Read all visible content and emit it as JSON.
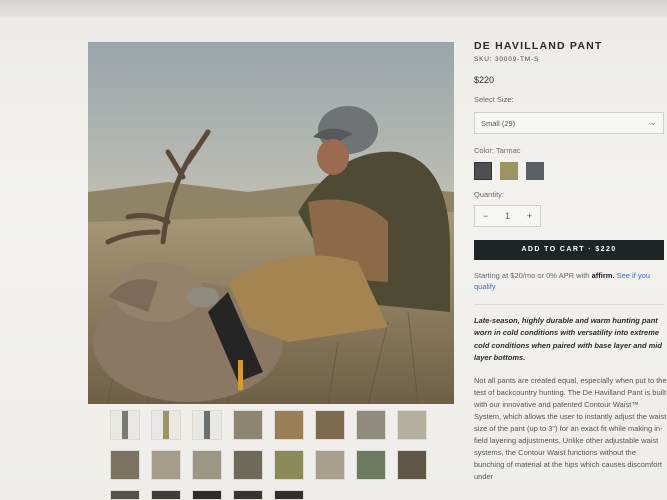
{
  "product": {
    "title": "DE HAVILLAND PANT",
    "sku": "SKU: 30009-TM-S",
    "price": "$220"
  },
  "size": {
    "label": "Select Size:",
    "selected": "Small (29)"
  },
  "color": {
    "label": "Color: Tarmac",
    "swatches": [
      "#4e4f50",
      "#9d9561",
      "#5b6064"
    ]
  },
  "quantity": {
    "label": "Quantity:",
    "minus": "−",
    "value": "1",
    "plus": "+"
  },
  "cart": {
    "button": "ADD TO CART  ·  $220"
  },
  "financing": {
    "text": "Starting at $20/mo or 0% APR with",
    "brand": "affirm.",
    "link": "See if you qualify"
  },
  "description": {
    "lead": "Late-season, highly durable and warm hunting pant worn in cold conditions with versatility into extreme cold conditions when paired with base layer and mid layer bottoms.",
    "body": "Not all pants are created equal, especially when put to the test of backcountry hunting. The De Havilland Pant is built with our innovative and patented Contour Waist™ System, which allows the user to instantly adjust the waist size of the pant (up to 3\") for an exact fit while making in-field layering adjustments. Unlike other adjustable waist systems, the Contour Waist functions without the bunching of material at the hips which causes discomfort under"
  },
  "icons": {
    "dropdown": "chevron-down-icon"
  },
  "colors": {
    "button_bg": "#1f2426",
    "link": "#3b6fc4"
  }
}
